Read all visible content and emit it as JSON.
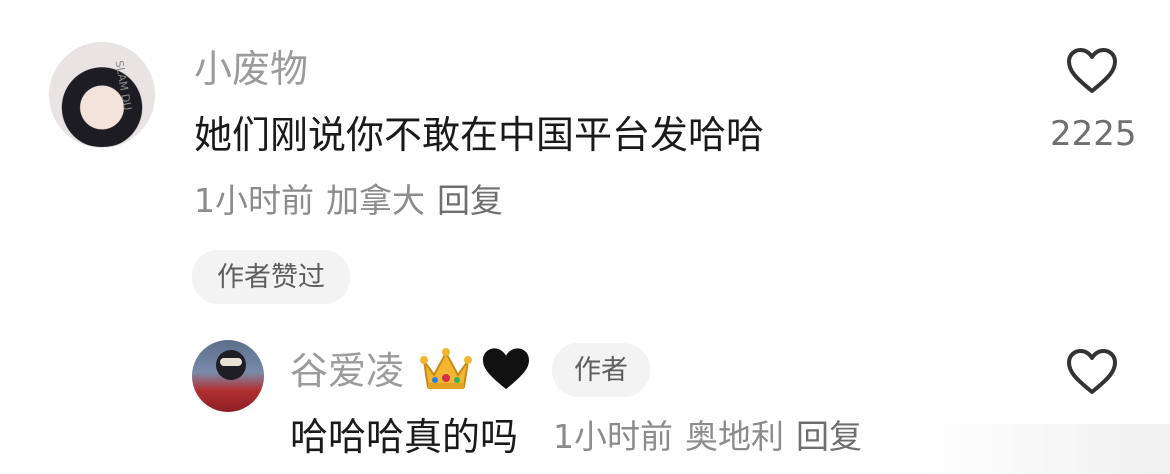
{
  "comment": {
    "username": "小废物",
    "text": "她们刚说你不敢在中国平台发哈哈",
    "time": "1小时前",
    "location": "加拿大",
    "reply_label": "回复",
    "liked_by_author": "作者赞过",
    "like_count": "2225",
    "avatar_text": "SLAM DU"
  },
  "reply": {
    "username": "谷爱凌",
    "badges": [
      "crown-icon",
      "black-heart-icon"
    ],
    "author_tag": "作者",
    "text": "哈哈哈真的吗",
    "time": "1小时前",
    "location": "奥地利",
    "reply_label": "回复"
  },
  "icons": [
    "heart-outline-icon"
  ],
  "colors": {
    "username": "#9b9b9b",
    "text": "#1a1a1a",
    "meta": "#8c8c8c",
    "pill_bg": "#f3f3f3"
  }
}
